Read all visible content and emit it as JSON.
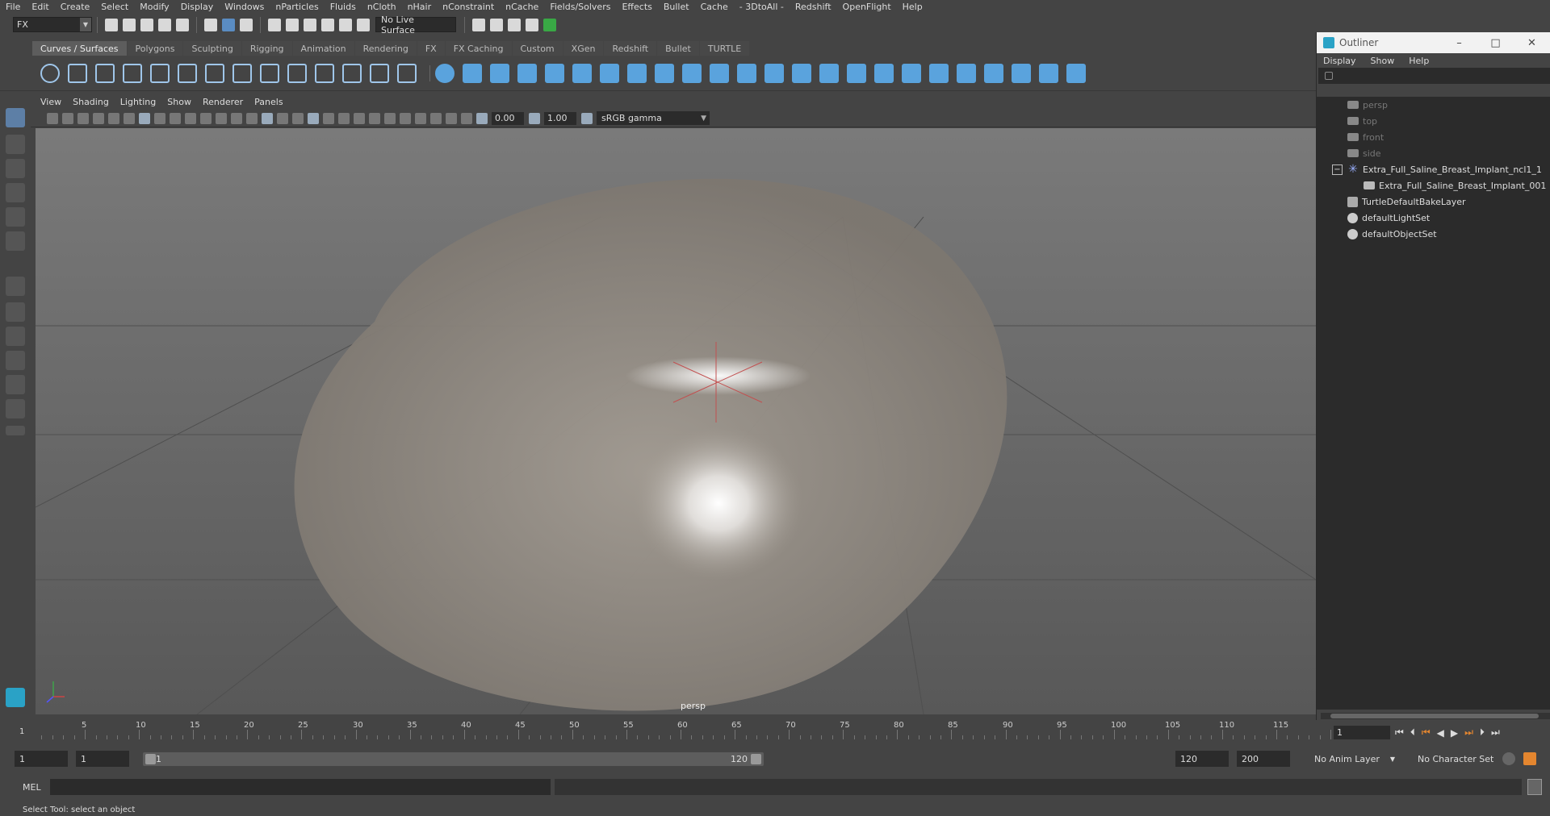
{
  "menubar": {
    "items": [
      "File",
      "Edit",
      "Create",
      "Select",
      "Modify",
      "Display",
      "Windows",
      "nParticles",
      "Fluids",
      "nCloth",
      "nHair",
      "nConstraint",
      "nCache",
      "Fields/Solvers",
      "Effects",
      "Bullet",
      "Cache",
      "- 3DtoAll -",
      "Redshift",
      "OpenFlight",
      "Help"
    ]
  },
  "statusline": {
    "mode": "FX",
    "live_surface": "No Live Surface"
  },
  "shelf": {
    "tabs": [
      "Curves / Surfaces",
      "Polygons",
      "Sculpting",
      "Rigging",
      "Animation",
      "Rendering",
      "FX",
      "FX Caching",
      "Custom",
      "XGen",
      "Redshift",
      "Bullet",
      "TURTLE"
    ],
    "active_tab": "Curves / Surfaces"
  },
  "viewport": {
    "menu": [
      "View",
      "Shading",
      "Lighting",
      "Show",
      "Renderer",
      "Panels"
    ],
    "exposure": "0.00",
    "gamma_value": "1.00",
    "color_space": "sRGB gamma",
    "camera_label": "persp"
  },
  "outliner": {
    "title": "Outliner",
    "menu": [
      "Display",
      "Show",
      "Help"
    ],
    "items": [
      {
        "label": "persp",
        "type": "camera",
        "dim": true
      },
      {
        "label": "top",
        "type": "camera",
        "dim": true
      },
      {
        "label": "front",
        "type": "camera",
        "dim": true
      },
      {
        "label": "side",
        "type": "camera",
        "dim": true
      },
      {
        "label": "Extra_Full_Saline_Breast_Implant_ncl1_1",
        "type": "group",
        "expanded": true
      },
      {
        "label": "Extra_Full_Saline_Breast_Implant_001",
        "type": "mesh",
        "child": true
      },
      {
        "label": "TurtleDefaultBakeLayer",
        "type": "node"
      },
      {
        "label": "defaultLightSet",
        "type": "set"
      },
      {
        "label": "defaultObjectSet",
        "type": "set"
      }
    ]
  },
  "timeline": {
    "ticks": [
      5,
      10,
      15,
      20,
      25,
      30,
      35,
      40,
      45,
      50,
      55,
      60,
      65,
      70,
      75,
      80,
      85,
      90,
      95,
      100,
      105,
      110,
      115
    ],
    "current_frame": "1",
    "frame_field": "1"
  },
  "range": {
    "start": "1",
    "playback_start": "1",
    "slider_start": "1",
    "slider_end": "120",
    "playback_end": "120",
    "end": "200",
    "anim_layer": "No Anim Layer",
    "character_set": "No Character Set"
  },
  "cmdline": {
    "mode": "MEL"
  },
  "helpline": {
    "text": "Select Tool: select an object"
  }
}
